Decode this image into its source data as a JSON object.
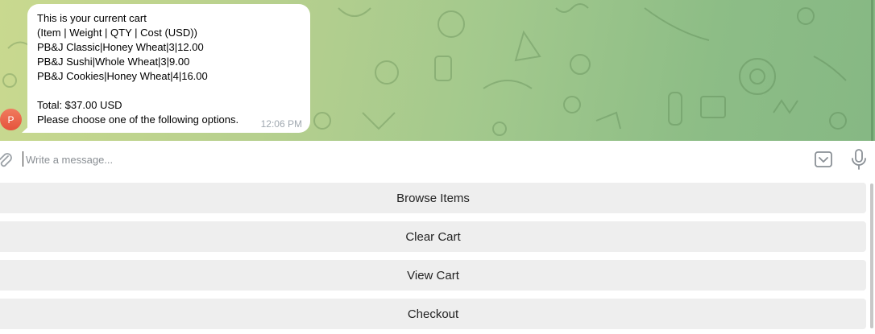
{
  "chat": {
    "avatar_letter": "P",
    "message": {
      "lines": [
        "This is your current cart",
        "(Item | Weight | QTY | Cost (USD))",
        "PB&J Classic|Honey Wheat|3|12.00",
        "PB&J Sushi|Whole Wheat|3|9.00",
        "PB&J Cookies|Honey Wheat|4|16.00",
        "",
        "Total: $37.00 USD",
        "Please choose one of the following options."
      ],
      "time": "12:06 PM"
    }
  },
  "input": {
    "placeholder": "Write a message..."
  },
  "icons": {
    "attach": "paperclip-icon",
    "emoji": "bot-keyboard-icon",
    "mic": "microphone-icon"
  },
  "keyboard": {
    "buttons": [
      {
        "label": "Browse Items"
      },
      {
        "label": "Clear Cart"
      },
      {
        "label": "View Cart"
      },
      {
        "label": "Checkout"
      }
    ]
  },
  "colors": {
    "bubble": "#ffffff",
    "avatar": "#e5533c",
    "keyboard_button": "#eeeeee"
  }
}
